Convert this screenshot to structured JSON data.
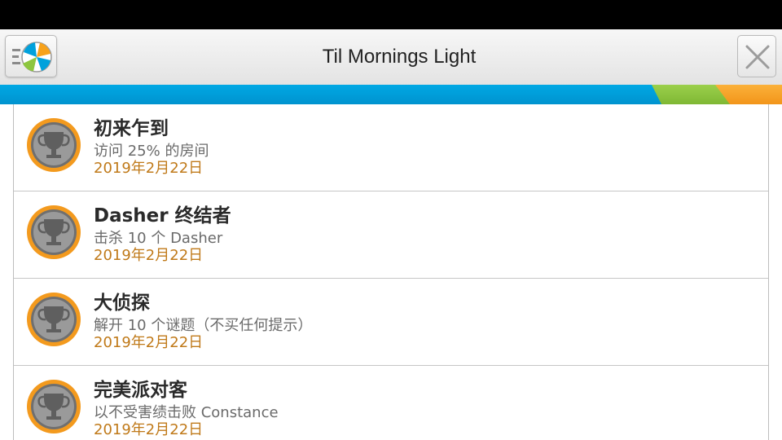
{
  "header": {
    "title": "Til Mornings Light",
    "menu_icon": "app-menu-icon",
    "close_icon": "close-icon"
  },
  "colors": {
    "band_blue": "#00a1dc",
    "band_green": "#8dc63f",
    "band_orange": "#f7a21b",
    "date_text": "#c07a1a",
    "badge_ring": "#f39a1e"
  },
  "achievements": [
    {
      "title": "初来乍到",
      "description": "访问 25% 的房间",
      "date": "2019年2月22日",
      "icon": "trophy-icon"
    },
    {
      "title": "Dasher 终结者",
      "description": "击杀 10 个 Dasher",
      "date": "2019年2月22日",
      "icon": "trophy-icon"
    },
    {
      "title": "大侦探",
      "description": "解开 10 个谜题（不买任何提示）",
      "date": "2019年2月22日",
      "icon": "trophy-icon"
    },
    {
      "title": "完美派对客",
      "description": "以不受害绩击败 Constance",
      "date": "2019年2月22日",
      "icon": "trophy-icon"
    }
  ]
}
